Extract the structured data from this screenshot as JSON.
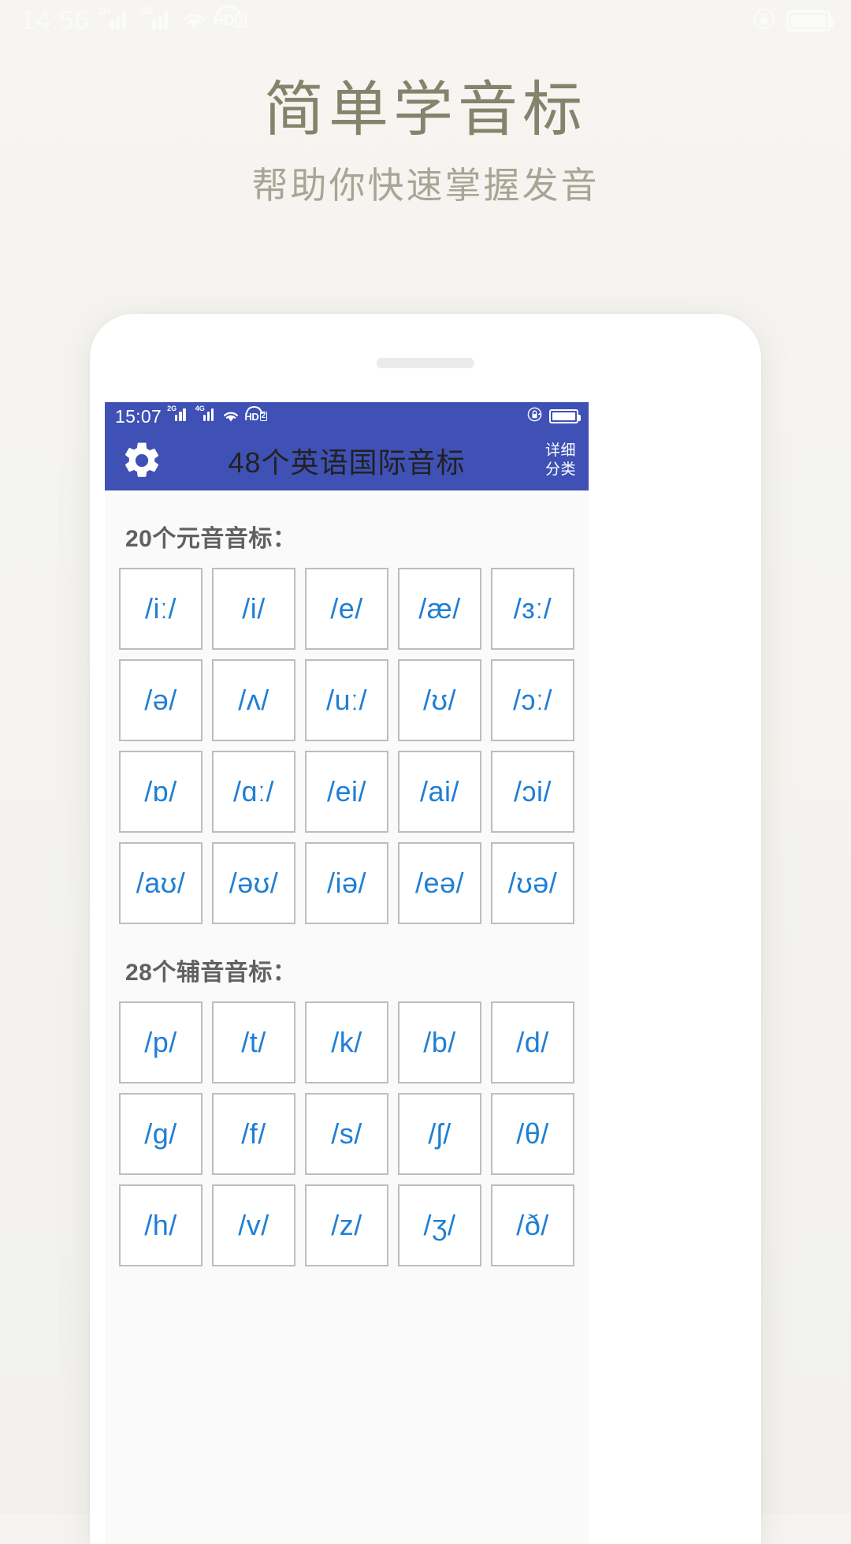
{
  "promo": {
    "title": "简单学音标",
    "subtitle": "帮助你快速掌握发音",
    "bg_color": "#f5f4f0",
    "title_color": "#85836b",
    "subtitle_color": "#a9a595"
  },
  "outer_status_bar": {
    "time": "14:56",
    "signal_1_label": "2G",
    "signal_2_label": "4G",
    "wifi_icon": "wifi-icon",
    "hd_label": "HD",
    "hd_badge": "2",
    "rotation_lock_icon": "rotation-lock-icon",
    "battery_icon": "battery-full-icon",
    "icon_color": "#fafaf8"
  },
  "phone": {
    "speaker_grille": "speaker-grille"
  },
  "inner_status_bar": {
    "time": "15:07",
    "signal_1_label": "2G",
    "signal_2_label": "4G",
    "wifi_icon": "wifi-icon",
    "hd_label": "HD",
    "hd_badge": "2",
    "rotation_lock_icon": "rotation-lock-icon",
    "battery_icon": "battery-full-icon"
  },
  "app": {
    "accent_color": "#3f51b5",
    "tile_text_color": "#1f7fd4",
    "toolbar": {
      "settings_icon": "gear-icon",
      "title": "48个英语国际音标",
      "action_line_1": "详细",
      "action_line_2": "分类"
    },
    "sections": [
      {
        "header": "20个元音音标：",
        "tiles": [
          "/iː/",
          "/i/",
          "/e/",
          "/æ/",
          "/ɜː/",
          "/ə/",
          "/ʌ/",
          "/uː/",
          "/ʊ/",
          "/ɔː/",
          "/ɒ/",
          "/ɑː/",
          "/ei/",
          "/ai/",
          "/ɔi/",
          "/aʊ/",
          "/əʊ/",
          "/iə/",
          "/eə/",
          "/ʊə/"
        ]
      },
      {
        "header": "28个辅音音标：",
        "tiles": [
          "/p/",
          "/t/",
          "/k/",
          "/b/",
          "/d/",
          "/g/",
          "/f/",
          "/s/",
          "/ʃ/",
          "/θ/",
          "/h/",
          "/v/",
          "/z/",
          "/ʒ/",
          "/ð/"
        ]
      }
    ]
  }
}
